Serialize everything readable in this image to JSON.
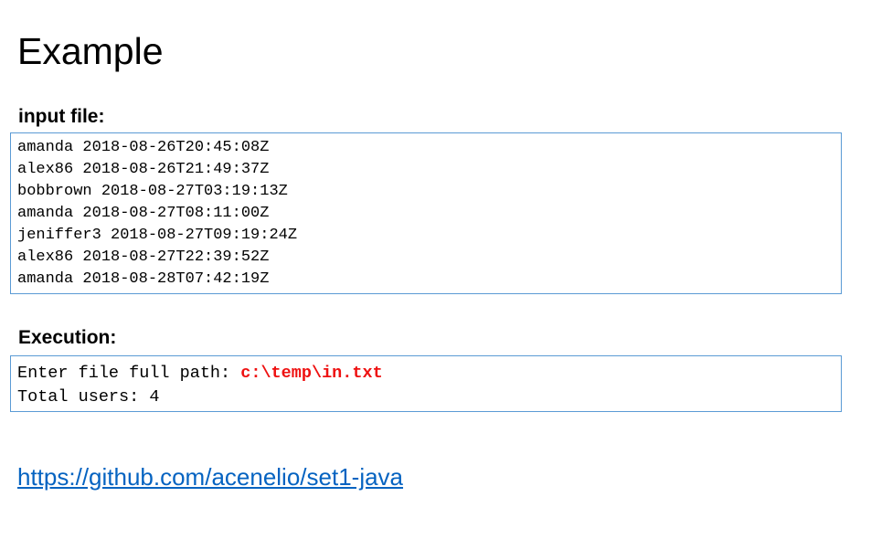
{
  "title": "Example",
  "input_section": {
    "heading": "input file:",
    "lines": [
      "amanda 2018-08-26T20:45:08Z",
      "alex86 2018-08-26T21:49:37Z",
      "bobbrown 2018-08-27T03:19:13Z",
      "amanda 2018-08-27T08:11:00Z",
      "jeniffer3 2018-08-27T09:19:24Z",
      "alex86 2018-08-27T22:39:52Z",
      "amanda 2018-08-28T07:42:19Z"
    ]
  },
  "execution_section": {
    "heading": "Execution:",
    "prompt": "Enter file full path: ",
    "entered_path": "c:\\temp\\in.txt",
    "result": "Total users: 4"
  },
  "link": {
    "text": "https://github.com/acenelio/set1-java"
  },
  "colors": {
    "box_border": "#5b9bd5",
    "highlight": "#ee1111",
    "link": "#0563c1"
  }
}
